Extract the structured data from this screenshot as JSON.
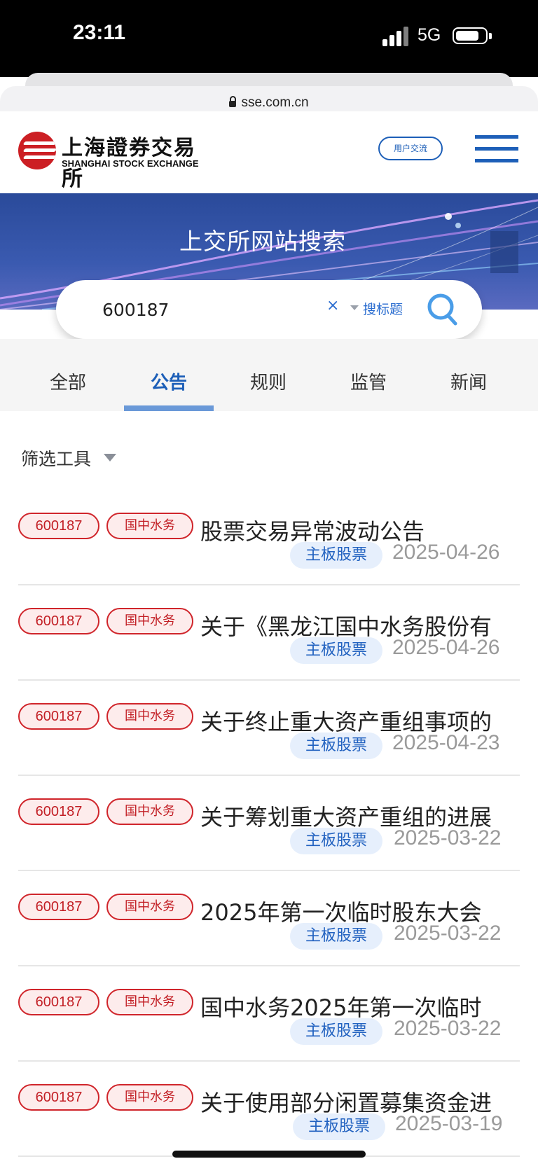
{
  "status_bar": {
    "time": "23:11",
    "network": "5G"
  },
  "browser": {
    "url": "sse.com.cn"
  },
  "header": {
    "logo_cn": "上海證券交易所",
    "logo_en": "SHANGHAI STOCK EXCHANGE",
    "user_exchange_label": "用户交流"
  },
  "banner": {
    "title": "上交所网站搜索"
  },
  "search": {
    "value": "600187",
    "clear": "×",
    "scope": "搜标题"
  },
  "tabs": [
    {
      "label": "全部"
    },
    {
      "label": "公告"
    },
    {
      "label": "规则"
    },
    {
      "label": "监管"
    },
    {
      "label": "新闻"
    }
  ],
  "active_tab": "公告",
  "filter": {
    "label": "筛选工具"
  },
  "results": [
    {
      "code": "600187",
      "name": "国中水务",
      "title": "股票交易异常波动公告",
      "board": "主板股票",
      "date": "2025-04-26"
    },
    {
      "code": "600187",
      "name": "国中水务",
      "title": "关于《黑龙江国中水务股份有",
      "board": "主板股票",
      "date": "2025-04-26"
    },
    {
      "code": "600187",
      "name": "国中水务",
      "title": "关于终止重大资产重组事项的",
      "board": "主板股票",
      "date": "2025-04-23"
    },
    {
      "code": "600187",
      "name": "国中水务",
      "title": "关于筹划重大资产重组的进展",
      "board": "主板股票",
      "date": "2025-03-22"
    },
    {
      "code": "600187",
      "name": "国中水务",
      "title": "2025年第一次临时股东大会",
      "board": "主板股票",
      "date": "2025-03-22"
    },
    {
      "code": "600187",
      "name": "国中水务",
      "title": "国中水务2025年第一次临时",
      "board": "主板股票",
      "date": "2025-03-22"
    },
    {
      "code": "600187",
      "name": "国中水务",
      "title": "关于使用部分闲置募集资金进",
      "board": "主板股票",
      "date": "2025-03-19"
    }
  ],
  "colors": {
    "brand_blue": "#1d5fb8",
    "tag_red": "#c21e24",
    "logo_red": "#cc1f24"
  }
}
